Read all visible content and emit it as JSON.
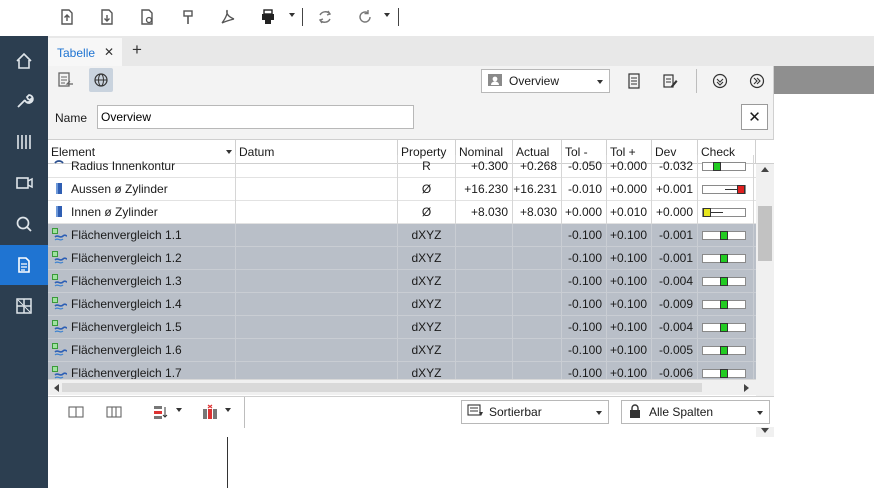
{
  "toolbar": {
    "icons": [
      "import-icon",
      "export-icon",
      "settings-export-icon",
      "pin-icon",
      "pdf-icon",
      "print-icon",
      "refresh-icon",
      "redo-icon"
    ]
  },
  "nav": {
    "items": [
      "home-icon",
      "wrench-icon",
      "columns-icon",
      "camera-icon",
      "search-icon",
      "report-icon",
      "grid-icon"
    ],
    "active": "report-icon"
  },
  "tabs": {
    "active_label": "Tabelle",
    "add_label": "+"
  },
  "panel": {
    "view_dropdown": "Overview",
    "name_label": "Name",
    "name_value": "Overview"
  },
  "table": {
    "columns": [
      "Element",
      "Datum",
      "Property",
      "Nominal",
      "Actual",
      "Tol -",
      "Tol +",
      "Dev",
      "Check"
    ],
    "rows": [
      {
        "element": "Radius Innenkontur",
        "datum": "",
        "property": "R",
        "nominal": "+0.300",
        "actual": "+0.268",
        "tol_minus": "-0.050",
        "tol_plus": "+0.000",
        "dev": "-0.032",
        "icon": "radius-icon",
        "gray": false,
        "check_color": "#22cc22",
        "check_pos": 0.3
      },
      {
        "element": "Aussen ø Zylinder",
        "datum": "",
        "property": "Ø",
        "nominal": "+16.230",
        "actual": "+16.231",
        "tol_minus": "-0.010",
        "tol_plus": "+0.000",
        "dev": "+0.001",
        "icon": "cylinder-icon",
        "gray": false,
        "check_color": "#e02020",
        "check_pos": 1.0
      },
      {
        "element": "Innen ø Zylinder",
        "datum": "",
        "property": "Ø",
        "nominal": "+8.030",
        "actual": "+8.030",
        "tol_minus": "+0.000",
        "tol_plus": "+0.010",
        "dev": "+0.000",
        "icon": "cylinder-icon",
        "gray": false,
        "check_color": "#e6e61e",
        "check_pos": 0.0
      },
      {
        "element": "Flächenvergleich 1.1",
        "datum": "",
        "property": "dXYZ",
        "nominal": "",
        "actual": "",
        "tol_minus": "-0.100",
        "tol_plus": "+0.100",
        "dev": "-0.001",
        "icon": "surface-compare-icon",
        "gray": true,
        "check_color": "#22cc22",
        "check_pos": 0.5
      },
      {
        "element": "Flächenvergleich 1.2",
        "datum": "",
        "property": "dXYZ",
        "nominal": "",
        "actual": "",
        "tol_minus": "-0.100",
        "tol_plus": "+0.100",
        "dev": "-0.001",
        "icon": "surface-compare-icon",
        "gray": true,
        "check_color": "#22cc22",
        "check_pos": 0.5
      },
      {
        "element": "Flächenvergleich 1.3",
        "datum": "",
        "property": "dXYZ",
        "nominal": "",
        "actual": "",
        "tol_minus": "-0.100",
        "tol_plus": "+0.100",
        "dev": "-0.004",
        "icon": "surface-compare-icon",
        "gray": true,
        "check_color": "#22cc22",
        "check_pos": 0.5
      },
      {
        "element": "Flächenvergleich 1.4",
        "datum": "",
        "property": "dXYZ",
        "nominal": "",
        "actual": "",
        "tol_minus": "-0.100",
        "tol_plus": "+0.100",
        "dev": "-0.009",
        "icon": "surface-compare-icon",
        "gray": true,
        "check_color": "#22cc22",
        "check_pos": 0.5
      },
      {
        "element": "Flächenvergleich 1.5",
        "datum": "",
        "property": "dXYZ",
        "nominal": "",
        "actual": "",
        "tol_minus": "-0.100",
        "tol_plus": "+0.100",
        "dev": "-0.004",
        "icon": "surface-compare-icon",
        "gray": true,
        "check_color": "#22cc22",
        "check_pos": 0.5
      },
      {
        "element": "Flächenvergleich 1.6",
        "datum": "",
        "property": "dXYZ",
        "nominal": "",
        "actual": "",
        "tol_minus": "-0.100",
        "tol_plus": "+0.100",
        "dev": "-0.005",
        "icon": "surface-compare-icon",
        "gray": true,
        "check_color": "#22cc22",
        "check_pos": 0.5
      },
      {
        "element": "Flächenvergleich 1.7",
        "datum": "",
        "property": "dXYZ",
        "nominal": "",
        "actual": "",
        "tol_minus": "-0.100",
        "tol_plus": "+0.100",
        "dev": "-0.006",
        "icon": "surface-compare-icon",
        "gray": true,
        "check_color": "#22cc22",
        "check_pos": 0.5
      }
    ]
  },
  "bottom": {
    "sort_dropdown": "Sortierbar",
    "columns_dropdown": "Alle Spalten"
  }
}
